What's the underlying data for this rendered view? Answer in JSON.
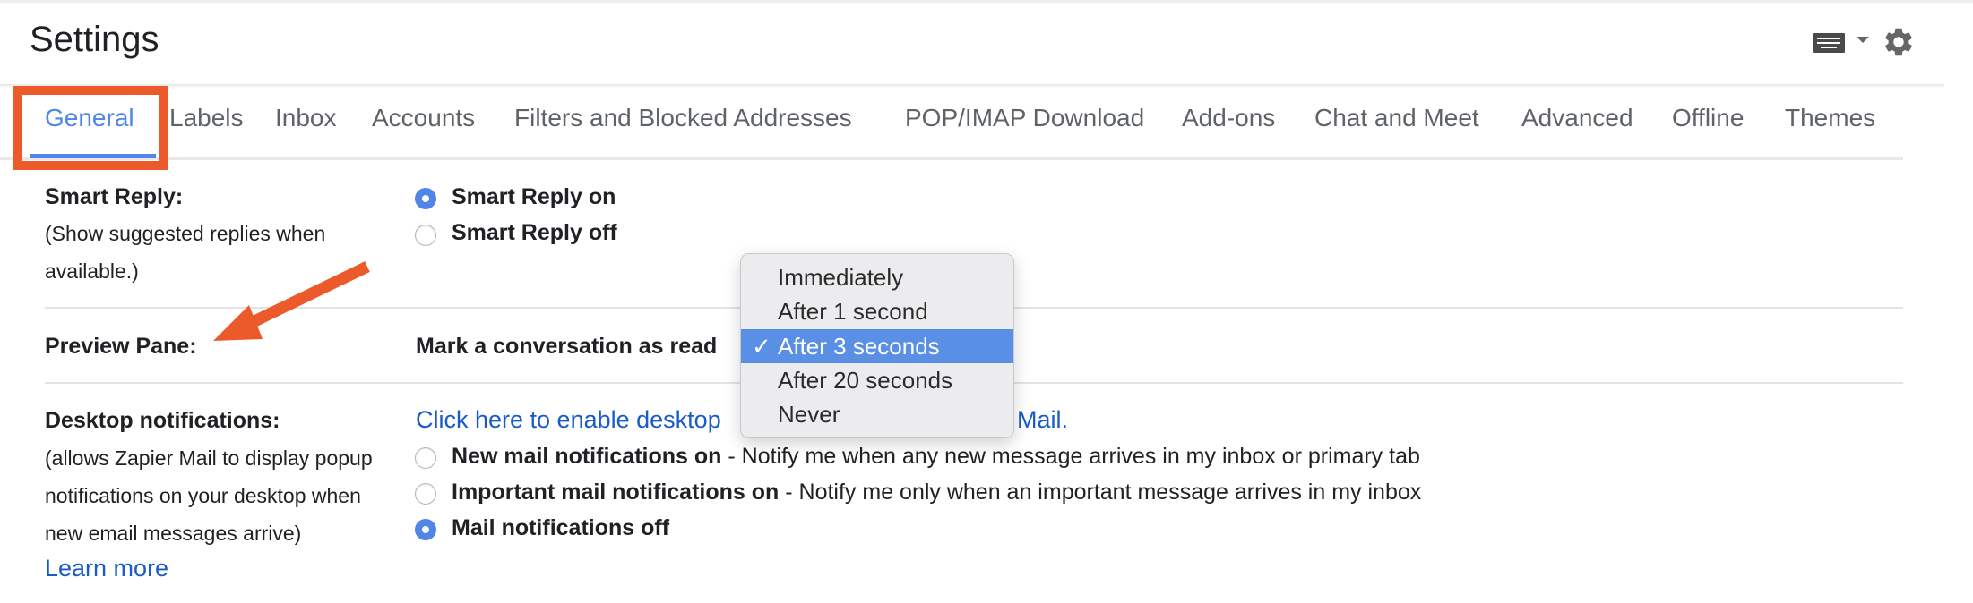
{
  "header": {
    "title": "Settings",
    "icons": {
      "keyboard": "keyboard-icon",
      "dropdown": "caret-down-icon",
      "settings": "gear-icon"
    }
  },
  "tabs": [
    {
      "label": "General",
      "active": true
    },
    {
      "label": "Labels",
      "active": false
    },
    {
      "label": "Inbox",
      "active": false
    },
    {
      "label": "Accounts",
      "active": false
    },
    {
      "label": "Filters and Blocked Addresses",
      "active": false
    },
    {
      "label": "POP/IMAP Download",
      "active": false
    },
    {
      "label": "Add-ons",
      "active": false
    },
    {
      "label": "Chat and Meet",
      "active": false
    },
    {
      "label": "Advanced",
      "active": false
    },
    {
      "label": "Offline",
      "active": false
    },
    {
      "label": "Themes",
      "active": false
    }
  ],
  "smart_reply": {
    "label": "Smart Reply:",
    "description_line1": "(Show suggested replies when",
    "description_line2": "available.)",
    "options": [
      {
        "label": "Smart Reply on",
        "selected": true
      },
      {
        "label": "Smart Reply off",
        "selected": false
      }
    ]
  },
  "preview_pane": {
    "label": "Preview Pane:",
    "mark_read_label": "Mark a conversation as read",
    "dropdown": {
      "options": [
        "Immediately",
        "After 1 second",
        "After 3 seconds",
        "After 20 seconds",
        "Never"
      ],
      "selected": "After 3 seconds",
      "check_glyph": "✓"
    }
  },
  "desktop_notifications": {
    "label": "Desktop notifications:",
    "description_lines": [
      "(allows Zapier Mail to display popup",
      "notifications on your desktop when",
      "new email messages arrive)"
    ],
    "learn_more": "Learn more",
    "enable_link_visible_start": "Click here to enable desktop",
    "enable_link_visible_end": "Mail.",
    "options": [
      {
        "bold": "New mail notifications on",
        "rest": " - Notify me when any new message arrives in my inbox or primary tab",
        "selected": false
      },
      {
        "bold": "Important mail notifications on",
        "rest": " - Notify me only when an important message arrives in my inbox",
        "selected": false
      },
      {
        "bold": "Mail notifications off",
        "rest": "",
        "selected": true
      }
    ]
  },
  "annotations": {
    "highlight_color": "#ec5a2c",
    "highlight_target": "General tab",
    "arrow_target": "Preview Pane"
  },
  "colors": {
    "accent": "#4f86e8",
    "link": "#1a5bc8",
    "text": "#202124",
    "tab_text": "#5f6368",
    "dropdown_selected": "#5a8fe6"
  }
}
